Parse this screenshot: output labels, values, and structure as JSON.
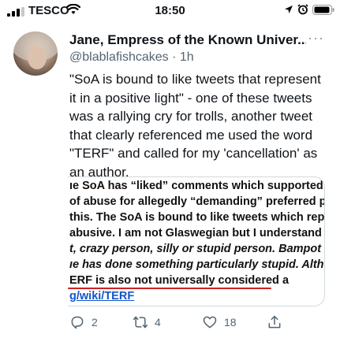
{
  "status_bar": {
    "carrier": "TESCO",
    "time": "18:50"
  },
  "tweet": {
    "display_name": "Jane, Empress of the Known Univer...",
    "handle_line": "@blablafishcakes · 1h",
    "body": "\"SoA is bound to like tweets that represent it in a positive light\" - one of these tweets was a rallying cry for trolls, another tweet that clearly referenced me used the word \"TERF\" and called for my 'cancellation' as an author.",
    "more_label": "···"
  },
  "media": {
    "lines": [
      "ıe SoA has “liked” comments which supported th",
      " of abuse for allegedly “demanding” preferred pr",
      "this. The SoA is bound to like tweets which repres",
      " abusive. I am not Glaswegian but I understand th",
      "t, crazy person, silly or stupid person. Bampot is a",
      "ıe has done something particularly stupid. Althou",
      "ERF is also not universally considered a",
      "ɡ/wiki/TERF"
    ]
  },
  "actions": {
    "reply_count": "2",
    "retweet_count": "4",
    "like_count": "18"
  },
  "colors": {
    "link": "#1155cc",
    "icon_gray": "#536471",
    "annotation_red": "#cc2222"
  }
}
